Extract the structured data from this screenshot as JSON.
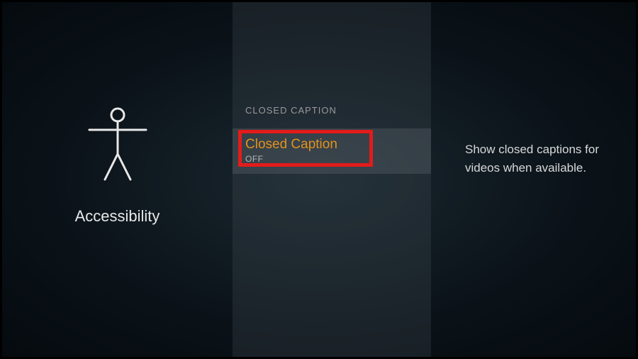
{
  "leftPanel": {
    "label": "Accessibility"
  },
  "middlePanel": {
    "sectionHeader": "CLOSED CAPTION",
    "setting": {
      "title": "Closed Caption",
      "value": "OFF"
    }
  },
  "rightPanel": {
    "description": "Show closed captions for videos when available."
  }
}
